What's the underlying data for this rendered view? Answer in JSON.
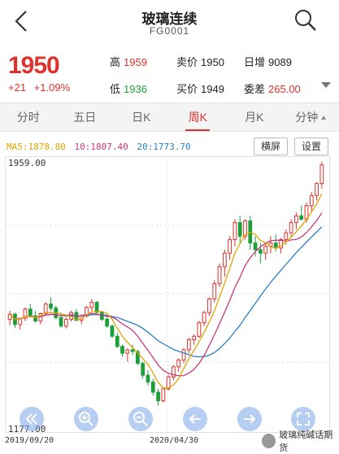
{
  "header": {
    "title": "玻璃连续",
    "code": "FG0001"
  },
  "quote": {
    "price": "1950",
    "change": "+21",
    "change_pct": "+1.09%",
    "high_label": "高",
    "high": "1959",
    "low_label": "低",
    "low": "1936",
    "ask_label": "卖价",
    "ask": "1950",
    "bid_label": "买价",
    "bid": "1949",
    "oi_label": "日增",
    "oi": "9089",
    "diff_label": "委差",
    "diff": "265.00"
  },
  "tabs": [
    {
      "label": "分时"
    },
    {
      "label": "五日"
    },
    {
      "label": "日K"
    },
    {
      "label": "周K"
    },
    {
      "label": "月K"
    },
    {
      "label": "分钟"
    }
  ],
  "active_tab": "周K",
  "indicators": {
    "ma5": "MA5:1878.80",
    "ma10": "10:1807.40",
    "ma20": "20:1773.70"
  },
  "buttons": {
    "landscape": "横屏",
    "settings": "设置"
  },
  "axis": {
    "y_top": "1959.00",
    "y_bottom": "1177.00",
    "x_left": "2019/09/20",
    "x_mid": "2020/04/30"
  },
  "watermark": "玻璃纯碱话期货",
  "colors": {
    "up": "#e0322d",
    "down": "#1e9e3a",
    "ma5": "#e0a400",
    "ma10": "#c83b7a",
    "ma20": "#2a7fc5"
  },
  "chart_data": {
    "type": "candlestick",
    "period": "weekly",
    "ylim": [
      1177,
      1959
    ],
    "x_labels": [
      "2019/09/20",
      "2020/04/30"
    ],
    "candles": [
      [
        1495,
        1520,
        1478,
        1510
      ],
      [
        1510,
        1515,
        1470,
        1480
      ],
      [
        1480,
        1500,
        1465,
        1498
      ],
      [
        1498,
        1530,
        1490,
        1525
      ],
      [
        1525,
        1540,
        1500,
        1505
      ],
      [
        1505,
        1520,
        1485,
        1490
      ],
      [
        1490,
        1515,
        1480,
        1512
      ],
      [
        1512,
        1545,
        1505,
        1540
      ],
      [
        1540,
        1560,
        1520,
        1528
      ],
      [
        1528,
        1535,
        1495,
        1500
      ],
      [
        1500,
        1515,
        1470,
        1475
      ],
      [
        1475,
        1500,
        1468,
        1495
      ],
      [
        1495,
        1520,
        1488,
        1515
      ],
      [
        1515,
        1525,
        1490,
        1492
      ],
      [
        1492,
        1510,
        1480,
        1505
      ],
      [
        1505,
        1535,
        1500,
        1530
      ],
      [
        1530,
        1555,
        1520,
        1545
      ],
      [
        1545,
        1550,
        1510,
        1515
      ],
      [
        1515,
        1520,
        1490,
        1495
      ],
      [
        1495,
        1505,
        1470,
        1475
      ],
      [
        1475,
        1480,
        1440,
        1445
      ],
      [
        1445,
        1455,
        1410,
        1415
      ],
      [
        1415,
        1420,
        1385,
        1395
      ],
      [
        1395,
        1410,
        1370,
        1405
      ],
      [
        1405,
        1420,
        1390,
        1400
      ],
      [
        1400,
        1405,
        1360,
        1365
      ],
      [
        1365,
        1370,
        1320,
        1330
      ],
      [
        1330,
        1345,
        1300,
        1310
      ],
      [
        1310,
        1320,
        1270,
        1280
      ],
      [
        1280,
        1290,
        1240,
        1255
      ],
      [
        1255,
        1295,
        1250,
        1290
      ],
      [
        1290,
        1330,
        1285,
        1325
      ],
      [
        1325,
        1360,
        1315,
        1355
      ],
      [
        1355,
        1380,
        1340,
        1375
      ],
      [
        1375,
        1410,
        1365,
        1405
      ],
      [
        1405,
        1440,
        1395,
        1435
      ],
      [
        1435,
        1450,
        1420,
        1445
      ],
      [
        1445,
        1490,
        1440,
        1485
      ],
      [
        1485,
        1520,
        1475,
        1515
      ],
      [
        1515,
        1560,
        1505,
        1555
      ],
      [
        1555,
        1610,
        1545,
        1600
      ],
      [
        1600,
        1660,
        1590,
        1650
      ],
      [
        1650,
        1700,
        1620,
        1690
      ],
      [
        1690,
        1740,
        1670,
        1730
      ],
      [
        1730,
        1790,
        1710,
        1780
      ],
      [
        1780,
        1800,
        1720,
        1740
      ],
      [
        1740,
        1790,
        1730,
        1785
      ],
      [
        1785,
        1800,
        1700,
        1720
      ],
      [
        1720,
        1740,
        1680,
        1700
      ],
      [
        1700,
        1720,
        1660,
        1690
      ],
      [
        1690,
        1720,
        1670,
        1710
      ],
      [
        1710,
        1740,
        1690,
        1720
      ],
      [
        1720,
        1745,
        1695,
        1705
      ],
      [
        1705,
        1735,
        1690,
        1730
      ],
      [
        1730,
        1760,
        1715,
        1750
      ],
      [
        1750,
        1790,
        1740,
        1780
      ],
      [
        1780,
        1810,
        1760,
        1800
      ],
      [
        1800,
        1830,
        1785,
        1790
      ],
      [
        1790,
        1840,
        1780,
        1830
      ],
      [
        1830,
        1870,
        1810,
        1860
      ],
      [
        1860,
        1900,
        1845,
        1895
      ],
      [
        1895,
        1959,
        1880,
        1950
      ]
    ]
  }
}
